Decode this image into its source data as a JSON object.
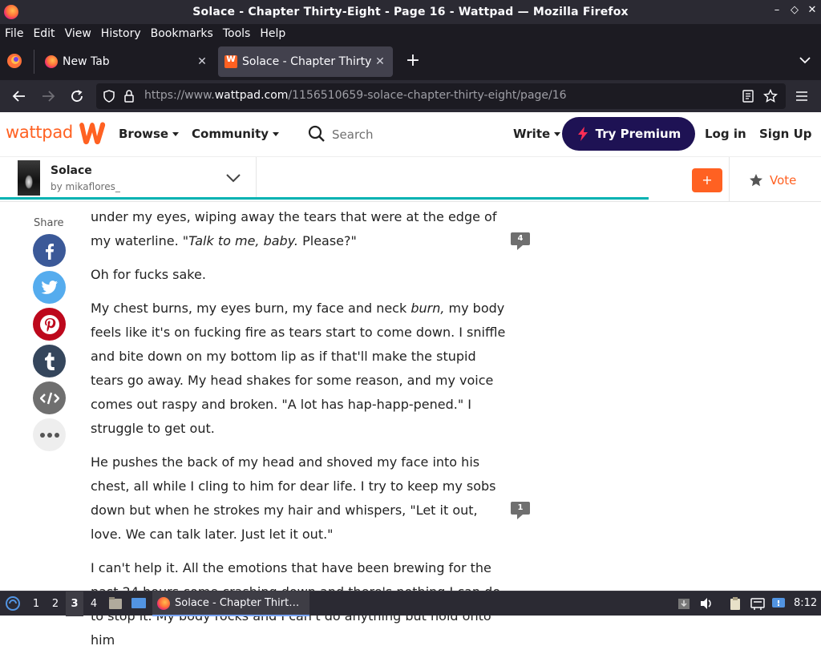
{
  "window": {
    "title": "Solace - Chapter Thirty-Eight - Page 16 - Wattpad — Mozilla Firefox",
    "minimize": "–",
    "maximize": "◇",
    "close": "✕"
  },
  "menu": [
    "File",
    "Edit",
    "View",
    "History",
    "Bookmarks",
    "Tools",
    "Help"
  ],
  "tabs": [
    {
      "label": "New Tab",
      "active": false
    },
    {
      "label": "Solace - Chapter Thirty-Eight - Page 16 - Wattpad",
      "active": true
    }
  ],
  "tab_close": "✕",
  "new_tab": "+",
  "address": {
    "prefix": "https://www.",
    "domain": "wattpad.com",
    "path": "/1156510659-solace-chapter-thirty-eight/page/16"
  },
  "header": {
    "logo": "wattpad",
    "browse": "Browse",
    "community": "Community",
    "search_placeholder": "Search",
    "write": "Write",
    "premium": "Try Premium",
    "login": "Log in",
    "signup": "Sign Up",
    "brand_color": "#ff6122",
    "premium_color": "#1e1254"
  },
  "story": {
    "title": "Solace",
    "author": "by mikaflores_",
    "add_label": "+",
    "vote_label": "Vote",
    "reading_progress": 0.79
  },
  "share": {
    "label": "Share",
    "buttons": [
      {
        "name": "facebook-icon",
        "color": "#3b5998"
      },
      {
        "name": "twitter-icon",
        "color": "#55acee"
      },
      {
        "name": "pinterest-icon",
        "color": "#bd081c"
      },
      {
        "name": "tumblr-icon",
        "color": "#35465c"
      },
      {
        "name": "embed-icon",
        "color": "#6f6f6f"
      },
      {
        "name": "more-icon",
        "color": "#eeeeee"
      }
    ]
  },
  "content": {
    "p1": "under my eyes, wiping away the tears that were at the edge of my waterline. \"",
    "p1_em": "Talk to me, baby.",
    "p1_end": " Please?\"",
    "p2": "Oh for fucks sake.",
    "p3a": "My chest burns, my eyes burn, my face and neck ",
    "p3_em": "burn,",
    "p3b": " my body feels like it's on fucking fire as tears start to come down. I sniffle and bite down on my bottom lip as if that'll make the stupid tears go away. My head shakes for some reason, and my voice comes out raspy and broken. \"A lot has hap-happ-pened.\" I struggle to get out.",
    "p4": "He pushes the back of my head and shoved my face into his chest, all while I cling to him for dear life. I try to keep my sobs down but when he strokes my hair and whispers, \"Let it out, love. We can talk later. Just let it out.\"",
    "p5": "I can't help it. All the emotions that have been brewing for the past 24 hours come crashing down and there's nothing I can do to stop it. My body rocks and I can't do anything but hold onto him",
    "comment_counts": [
      "4",
      "1"
    ]
  },
  "taskbar": {
    "workspaces": [
      "1",
      "2",
      "3",
      "4"
    ],
    "active_workspace": "3",
    "window_label": "Solace - Chapter Thirt…",
    "clock": "8:12"
  }
}
